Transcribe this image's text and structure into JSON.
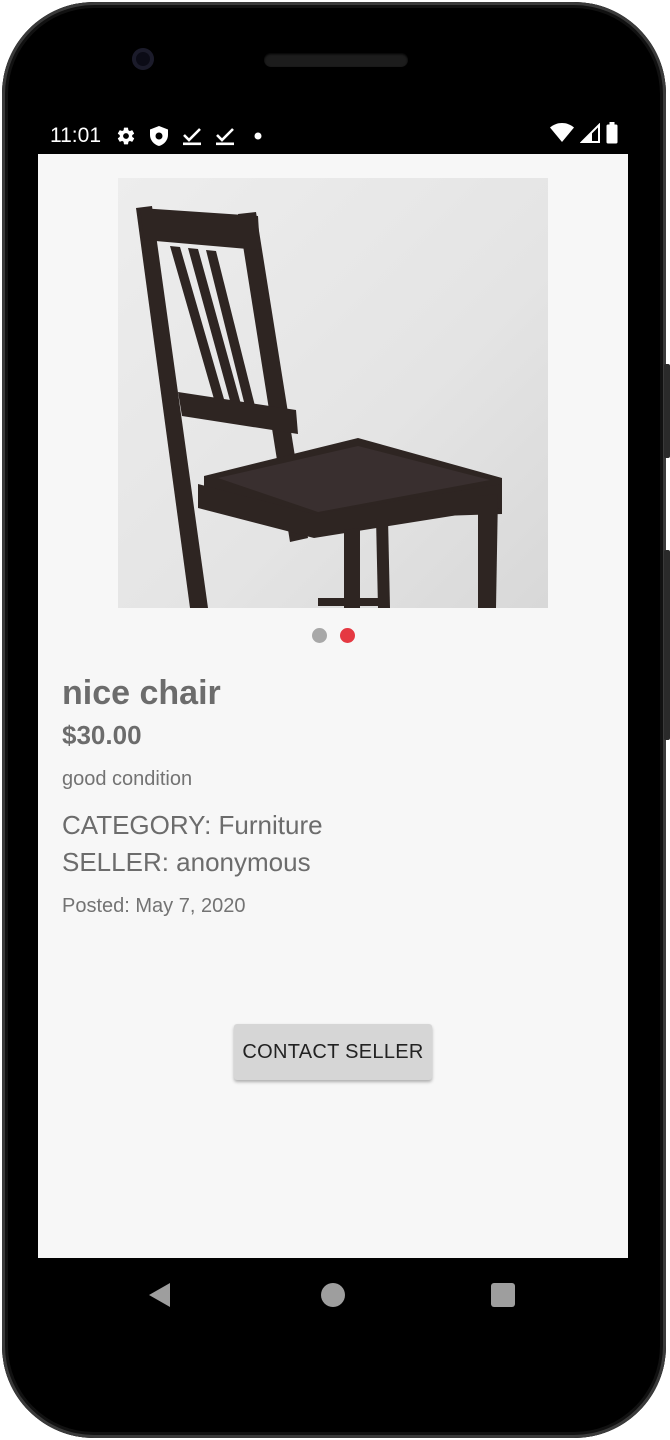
{
  "status_bar": {
    "time": "11:01",
    "left_icons": [
      "gear-icon",
      "shield-icon",
      "download-check-icon",
      "download-check-icon",
      "dot-icon"
    ],
    "right_icons": [
      "wifi-icon",
      "signal-icon",
      "battery-icon"
    ]
  },
  "listing": {
    "image_alt": "wooden chair",
    "carousel": {
      "count": 2,
      "active_index": 1
    },
    "title": "nice chair",
    "price": "$30.00",
    "description": "good condition",
    "category": "CATEGORY: Furniture",
    "seller": "SELLER: anonymous",
    "posted": "Posted: May 7, 2020"
  },
  "actions": {
    "contact_label": "CONTACT SELLER"
  },
  "colors": {
    "screen_bg": "#f7f7f7",
    "dot_active": "#e53942",
    "dot_inactive": "#a8a8a8",
    "text_gray": "#6c6c6c",
    "button_bg": "#d6d6d6"
  },
  "nav_bar": {
    "icons": [
      "back-icon",
      "home-icon",
      "recents-icon"
    ]
  }
}
